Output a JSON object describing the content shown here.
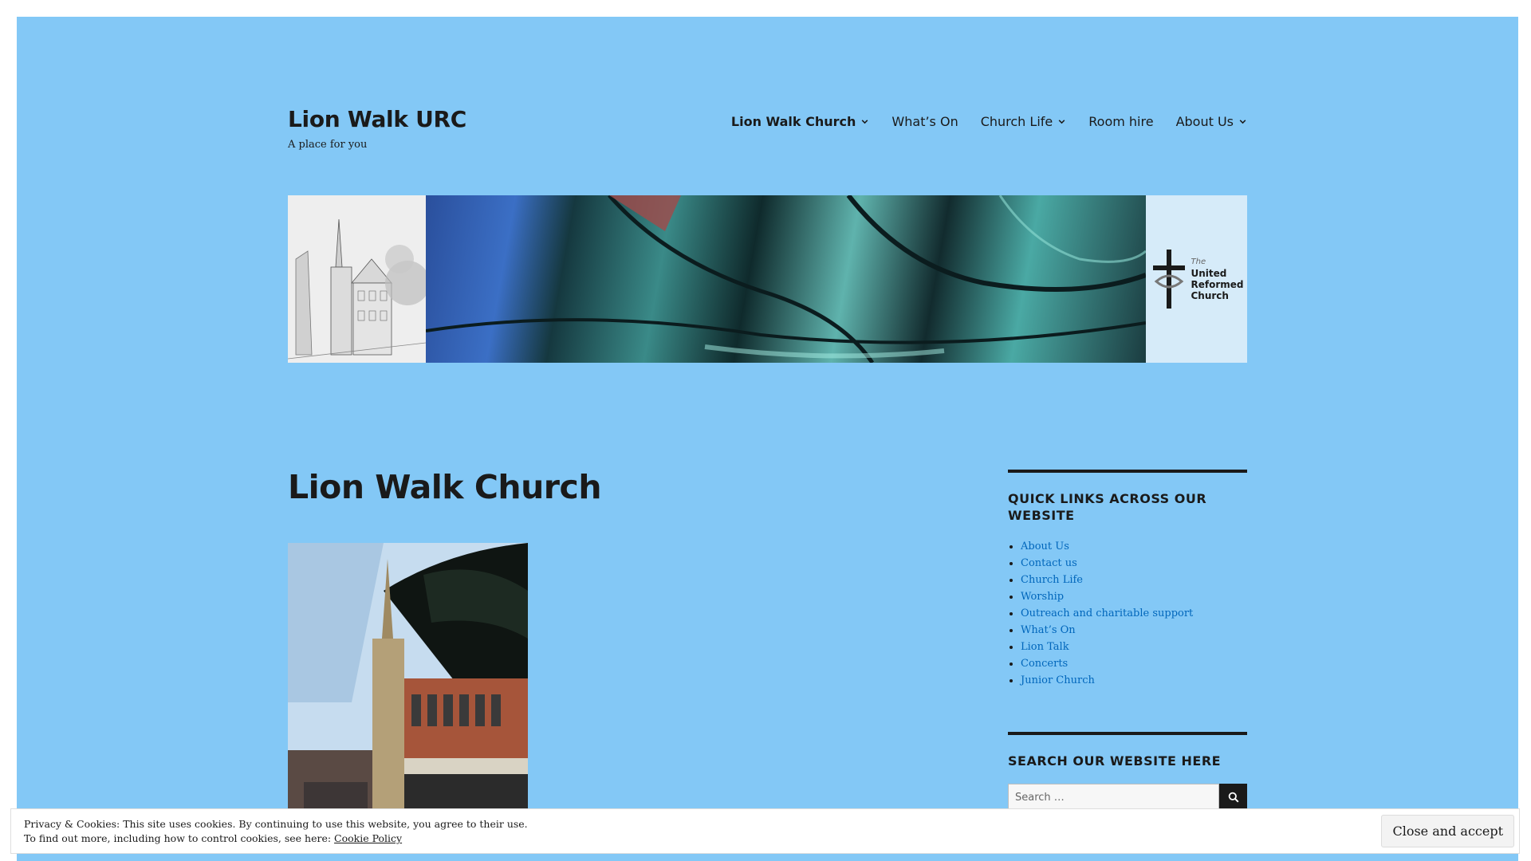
{
  "site": {
    "title": "Lion Walk URC",
    "tagline": "A place for you"
  },
  "nav": {
    "items": [
      {
        "label": "Lion Walk Church",
        "has_submenu": true,
        "current": true
      },
      {
        "label": "What’s On",
        "has_submenu": false,
        "current": false
      },
      {
        "label": "Church Life",
        "has_submenu": true,
        "current": false
      },
      {
        "label": "Room hire",
        "has_submenu": false,
        "current": false
      },
      {
        "label": "About Us",
        "has_submenu": true,
        "current": false
      }
    ]
  },
  "banner": {
    "logo": {
      "the": "The",
      "line1": "United",
      "line2": "Reformed",
      "line3": "Church"
    }
  },
  "page": {
    "title": "Lion Walk Church"
  },
  "sidebar": {
    "quick_links": {
      "title": "QUICK LINKS ACROSS OUR WEBSITE",
      "items": [
        "About Us",
        "Contact us",
        "Church Life",
        "Worship",
        "Outreach and charitable support",
        "What’s On",
        "Lion Talk",
        "Concerts",
        "Junior Church"
      ]
    },
    "search": {
      "title": "SEARCH OUR WEBSITE HERE",
      "placeholder": "Search …"
    }
  },
  "cookie": {
    "line1": "Privacy & Cookies: This site uses cookies. By continuing to use this website, you agree to their use.",
    "line2_prefix": "To find out more, including how to control cookies, see here: ",
    "policy_link": "Cookie Policy",
    "button": "Close and accept"
  },
  "colors": {
    "page_background": "#83c8f6",
    "link": "#0066bb",
    "text": "#1a1a1a"
  },
  "icons": {
    "submenu": "chevron-down-icon",
    "search": "search-icon",
    "logo": "urc-cross-icon"
  }
}
